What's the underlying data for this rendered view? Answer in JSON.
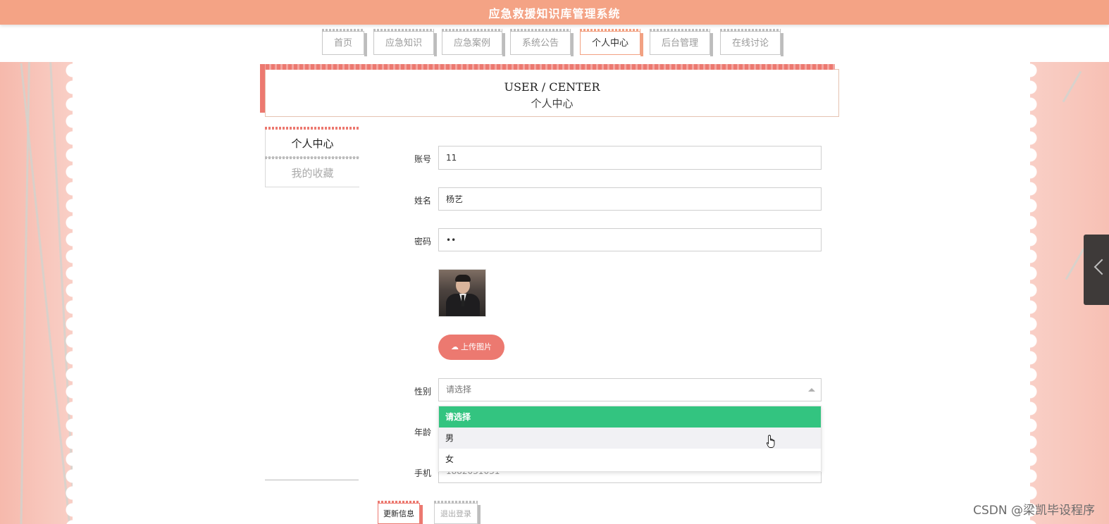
{
  "header": {
    "title": "应急救援知识库管理系统"
  },
  "nav": {
    "items": [
      {
        "label": "首页",
        "active": false
      },
      {
        "label": "应急知识",
        "active": false
      },
      {
        "label": "应急案例",
        "active": false
      },
      {
        "label": "系统公告",
        "active": false
      },
      {
        "label": "个人中心",
        "active": true
      },
      {
        "label": "后台管理",
        "active": false
      },
      {
        "label": "在线讨论",
        "active": false
      }
    ]
  },
  "page_title": {
    "en": "USER / CENTER",
    "cn": "个人中心"
  },
  "side_menu": {
    "items": [
      {
        "label": "个人中心",
        "active": true
      },
      {
        "label": "我的收藏",
        "active": false
      }
    ]
  },
  "form": {
    "account": {
      "label": "账号",
      "value": "11"
    },
    "name": {
      "label": "姓名",
      "value": "杨艺"
    },
    "password": {
      "label": "密码",
      "value": "••"
    },
    "upload_label": "上传图片",
    "gender": {
      "label": "性别",
      "placeholder": "请选择",
      "options": [
        "请选择",
        "男",
        "女"
      ]
    },
    "age": {
      "label": "年龄"
    },
    "phone": {
      "label": "手机",
      "value": "1882031031"
    }
  },
  "actions": {
    "update": "更新信息",
    "logout": "退出登录"
  },
  "watermark": "CSDN @梁凯毕设程序",
  "colors": {
    "header": "#f4a385",
    "accent": "#ec7970",
    "selected_option": "#33c480"
  }
}
